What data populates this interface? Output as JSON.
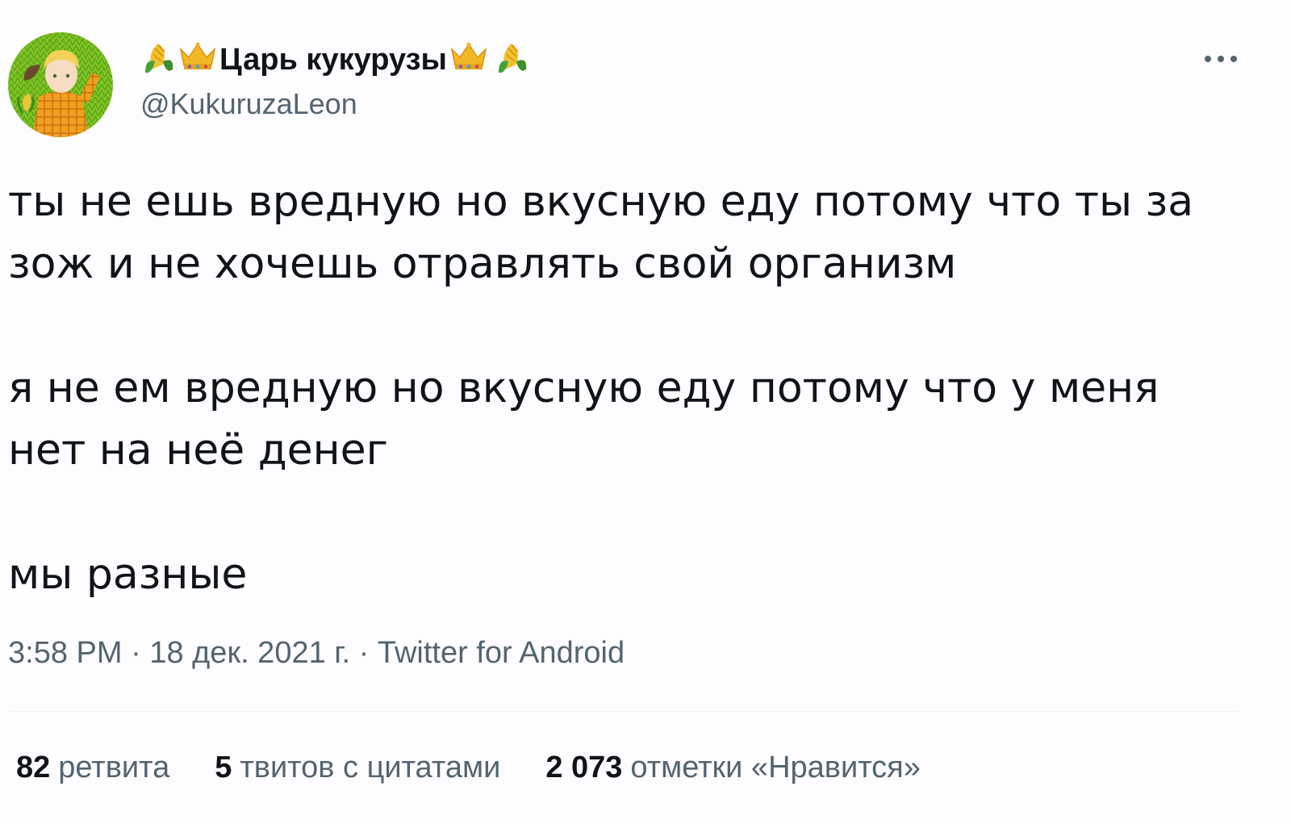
{
  "author": {
    "display_name": "Царь кукурузы",
    "handle": "@KukuruzaLeon",
    "name_decorations": [
      "corn-emoji",
      "crown-emoji"
    ]
  },
  "tweet": {
    "paragraphs": [
      "ты не ешь вредную но вкусную еду потому что ты за\nзож и не хочешь отравлять свой организм",
      "я не ем вредную но вкусную еду потому что у меня\nнет на неё денег",
      "мы разные"
    ],
    "time": "3:58 PM",
    "date": "18 дек. 2021 г.",
    "source": "Twitter for Android",
    "separator": "·"
  },
  "stats": {
    "retweets": {
      "count": "82",
      "label": "ретвита"
    },
    "quotes": {
      "count": "5",
      "label": "твитов с цитатами"
    },
    "likes": {
      "count": "2 073",
      "label": "отметки «Нравится»"
    }
  },
  "colors": {
    "text": "#0f1419",
    "secondary": "#536471",
    "divider": "#eff3f4",
    "background": "#fdfdff"
  }
}
